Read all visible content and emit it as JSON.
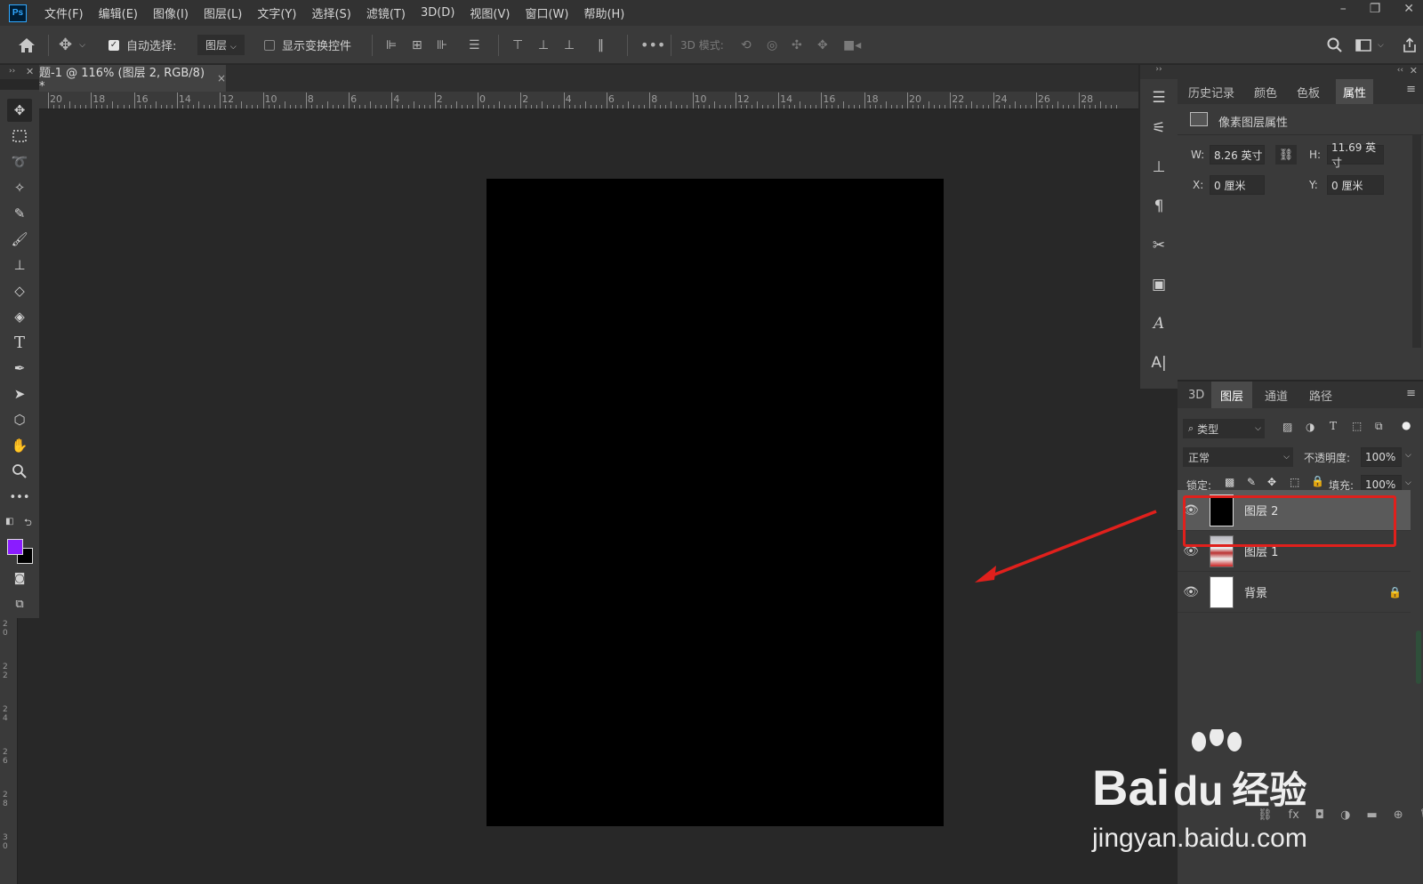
{
  "app": {
    "logo": "Ps",
    "menu": [
      "文件(F)",
      "编辑(E)",
      "图像(I)",
      "图层(L)",
      "文字(Y)",
      "选择(S)",
      "滤镜(T)",
      "3D(D)",
      "视图(V)",
      "窗口(W)",
      "帮助(H)"
    ],
    "window_controls": [
      "–",
      "❐",
      "✕"
    ]
  },
  "options_bar": {
    "auto_select_label": "自动选择:",
    "auto_select_target": "图层",
    "show_transform_label": "显示变换控件",
    "mode_3d_label": "3D 模式:"
  },
  "document": {
    "tab_title": "题-1 @ 116% (图层 2, RGB/8) *",
    "tab_close": "×",
    "ruler_labels": [
      "20",
      "18",
      "16",
      "14",
      "12",
      "10",
      "8",
      "6",
      "4",
      "2",
      "0",
      "2",
      "4",
      "6",
      "8",
      "10",
      "12",
      "14",
      "16",
      "18",
      "20",
      "22",
      "24",
      "26",
      "28"
    ],
    "vruler_labels": [
      "2\n0",
      "2\n2",
      "2\n4",
      "2\n6",
      "2\n8",
      "3\n0"
    ]
  },
  "properties": {
    "tabs": [
      "历史记录",
      "颜色",
      "色板",
      "属性"
    ],
    "active_tab": "属性",
    "header": "像素图层属性",
    "w_label": "W:",
    "w_value": "8.26 英寸",
    "h_label": "H:",
    "h_value": "11.69 英寸",
    "x_label": "X:",
    "x_value": "0 厘米",
    "y_label": "Y:",
    "y_value": "0 厘米"
  },
  "layers": {
    "tabs": [
      "3D",
      "图层",
      "通道",
      "路径"
    ],
    "active_tab": "图层",
    "filter_label": "类型",
    "blend_mode": "正常",
    "opacity_label": "不透明度:",
    "opacity_value": "100%",
    "lock_label": "锁定:",
    "fill_label": "填充:",
    "fill_value": "100%",
    "items": [
      {
        "name": "图层 2",
        "selected": true
      },
      {
        "name": "图层 1",
        "selected": false
      },
      {
        "name": "背景",
        "selected": false,
        "locked": true
      }
    ]
  },
  "colors": {
    "foreground": "#8a1cff",
    "background": "#000000",
    "highlight": "#e0201c"
  },
  "watermark": {
    "brand": "Bai",
    "brand2": "du",
    "cn": "经验",
    "url": "jingyan.baidu.com"
  }
}
